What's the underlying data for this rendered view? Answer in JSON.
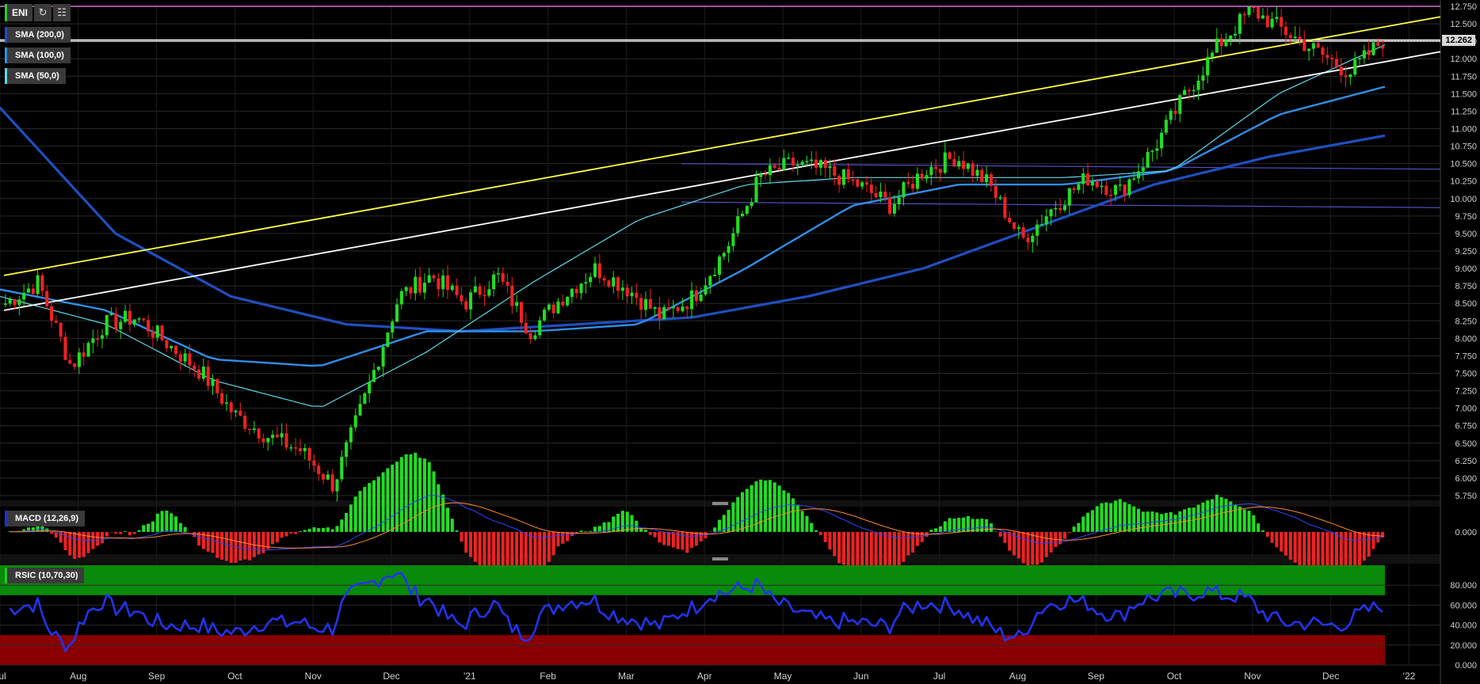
{
  "symbol": {
    "name": "ENI",
    "refresh_icon": "refresh-icon",
    "settings_icon": "calculator-icon"
  },
  "indicators": [
    {
      "label": "SMA (200,0)",
      "color": "#1f4fc0"
    },
    {
      "label": "SMA (100,0)",
      "color": "#2f8fe8"
    },
    {
      "label": "SMA (50,0)",
      "color": "#5fd8e8"
    }
  ],
  "macd_label": "MACD (12,26,9)",
  "rsic_label": "RSIC (10,70,30)",
  "current_price": "12.262",
  "colors": {
    "up": "#22dd22",
    "down": "#ee2222",
    "trend_yellow": "#ffff44",
    "trend_white": "#ffffff",
    "sma200": "#1f4fc0",
    "sma100": "#2f8fe8",
    "sma50": "#5fd8e8",
    "rsi_line": "#2233ee",
    "overbought": "#0a8a0a",
    "oversold": "#8a0000"
  },
  "chart_data": [
    {
      "type": "line",
      "title": "ENI",
      "x": [
        "Jul",
        "Aug",
        "Sep",
        "Oct",
        "Nov",
        "Dec",
        "'21",
        "Feb",
        "Mar",
        "Apr",
        "May",
        "Jun",
        "Jul",
        "Aug",
        "Sep",
        "Oct",
        "Nov",
        "Dec",
        "'22"
      ],
      "ylim": [
        5.75,
        12.75
      ],
      "yticks": [
        "12.750",
        "12.500",
        "12.250",
        "12.000",
        "11.750",
        "11.500",
        "11.250",
        "11.000",
        "10.750",
        "10.500",
        "10.250",
        "10.000",
        "9.750",
        "9.500",
        "9.250",
        "9.000",
        "8.750",
        "8.500",
        "8.250",
        "8.000",
        "7.750",
        "7.500",
        "7.250",
        "7.000",
        "6.750",
        "6.500",
        "6.250",
        "6.000",
        "5.750"
      ],
      "series": [
        {
          "name": "ENI",
          "values": [
            8.5,
            8.8,
            7.6,
            8.2,
            8.3,
            7.9,
            7.5,
            6.9,
            6.6,
            6.4,
            5.9,
            7.2,
            8.6,
            8.9,
            8.5,
            8.9,
            8.1,
            8.6,
            9.0,
            8.7,
            8.3,
            8.6,
            9.3,
            10.3,
            10.5,
            10.4,
            10.2,
            9.9,
            10.4,
            10.6,
            10.2,
            9.4,
            9.9,
            10.3,
            10.1,
            10.7,
            11.5,
            12.2,
            12.7,
            12.4,
            12.1,
            11.8,
            12.262
          ]
        },
        {
          "name": "SMA (200,0)",
          "values": [
            11.3,
            9.5,
            8.6,
            8.2,
            8.1,
            8.2,
            8.3,
            8.6,
            9.0,
            9.6,
            10.2,
            10.6,
            10.9
          ]
        },
        {
          "name": "SMA (100,0)",
          "values": [
            8.7,
            8.4,
            7.7,
            7.6,
            8.1,
            8.1,
            8.2,
            9.0,
            9.9,
            10.2,
            10.2,
            10.4,
            11.2,
            11.6
          ]
        },
        {
          "name": "SMA (50,0)",
          "values": [
            8.6,
            8.2,
            7.4,
            7.0,
            7.8,
            8.8,
            9.7,
            10.2,
            10.3,
            10.3,
            10.3,
            10.4,
            11.5,
            12.2
          ]
        }
      ],
      "trendlines": [
        {
          "name": "yellow",
          "from": 8.9,
          "to": 12.6
        },
        {
          "name": "white",
          "from": 8.4,
          "to": 12.1
        }
      ],
      "horizontal_levels": [
        12.75,
        12.25,
        12.27,
        10.5,
        9.95
      ]
    },
    {
      "type": "bar",
      "title": "MACD (12,26,9)",
      "yticks": [
        "0.000"
      ],
      "ylim": [
        -0.35,
        0.4
      ]
    },
    {
      "type": "line",
      "title": "RSIC (10,70,30)",
      "yticks": [
        "80.000",
        "60.000",
        "40.000",
        "20.000",
        "0.000"
      ],
      "ylim": [
        0,
        100
      ],
      "bands": [
        {
          "name": "overbought",
          "from": 70,
          "to": 100
        },
        {
          "name": "oversold",
          "from": 0,
          "to": 30
        }
      ]
    }
  ]
}
